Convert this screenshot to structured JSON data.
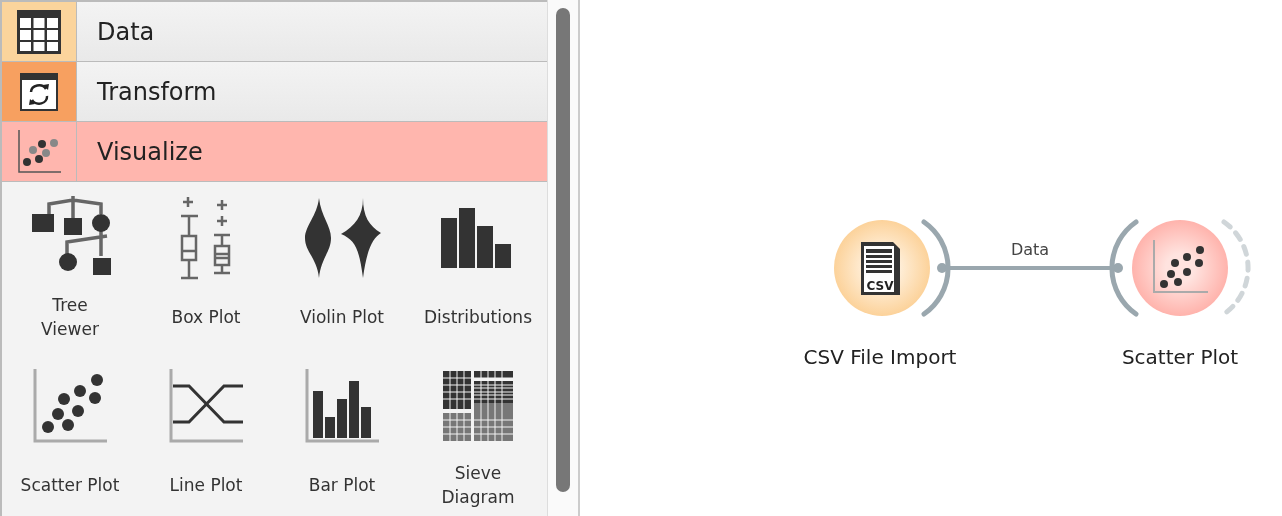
{
  "categories": [
    {
      "label": "Data",
      "kind": "table",
      "color": "#fbd49c",
      "expanded": false
    },
    {
      "label": "Transform",
      "kind": "transform",
      "color": "#f7a060",
      "expanded": false
    },
    {
      "label": "Visualize",
      "kind": "scatter",
      "color": "#ffb6ae",
      "expanded": true
    }
  ],
  "widgets": [
    {
      "label": "Tree\nViewer",
      "kind": "tree"
    },
    {
      "label": "Box Plot",
      "kind": "box"
    },
    {
      "label": "Violin Plot",
      "kind": "violin"
    },
    {
      "label": "Distributions",
      "kind": "distributions"
    },
    {
      "label": "Scatter Plot",
      "kind": "scatter"
    },
    {
      "label": "Line Plot",
      "kind": "line"
    },
    {
      "label": "Bar Plot",
      "kind": "bar"
    },
    {
      "label": "Sieve\nDiagram",
      "kind": "sieve"
    }
  ],
  "canvas": {
    "nodes": [
      {
        "label": "CSV File Import",
        "kind": "csv",
        "icon_text": "CSV",
        "color": "#fcd29a"
      },
      {
        "label": "Scatter Plot",
        "kind": "scatter",
        "color": "#ffb3ac"
      }
    ],
    "link": {
      "label": "Data"
    }
  }
}
